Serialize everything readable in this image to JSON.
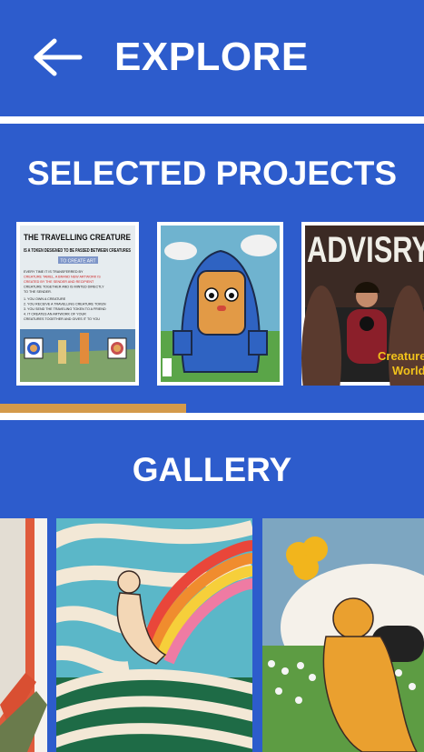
{
  "header": {
    "title": "EXPLORE",
    "back_icon": "arrow-left-icon"
  },
  "selected_projects": {
    "heading": "SELECTED PROJECTS",
    "scroll_progress": 0.44,
    "progress_color": "#d49a4a",
    "items": [
      {
        "title": "THE TRAVELLING CREATURE",
        "subtitle": "IS A TOKEN DESIGNED TO BE PASSED BETWEEN CREATURES",
        "note": "TO CREATE ART",
        "body": [
          "EVERY TIME IT IS TRANSFERRED BY",
          "CREATURE TAMEL, A BRAND NEW ARTWORK IS",
          "CREATED BY THE SENDER AND RECIPIENT",
          "CREATURE TOGETHER AND IS MINTED DIRECTLY",
          "TO THE SENDER.",
          "1. YOU OWN A CREATURE",
          "2. YOU RECEIVE A TRAVELLING CREATURE TOKEN",
          "3. YOU SEND THE TRAVELING TOKEN TO A FRIEND",
          "4. IT CREATES AN ARTWORK OF YOUR",
          "CREATURES TOGETHER AND GIVES IT TO YOU"
        ]
      },
      {
        "title": ""
      },
      {
        "title": "ADVISRY",
        "caption_line1": "Creature",
        "caption_line2": "World"
      }
    ]
  },
  "gallery": {
    "heading": "GALLERY"
  },
  "colors": {
    "brand_blue": "#2d5ccc",
    "accent_gold": "#d49a4a",
    "white": "#ffffff"
  }
}
